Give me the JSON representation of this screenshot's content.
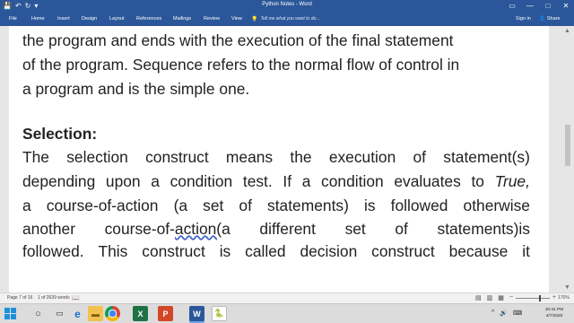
{
  "titlebar": {
    "title": "Python Notes - Word",
    "qat": {
      "save": "💾",
      "undo": "↶",
      "redo": "↻",
      "more": "▾"
    },
    "window_controls": {
      "ribbon_display": "▭",
      "minimize": "—",
      "maximize": "□",
      "close": "✕"
    }
  },
  "ribbon": {
    "tabs": [
      "File",
      "Home",
      "Insert",
      "Design",
      "Layout",
      "References",
      "Mailings",
      "Review",
      "View"
    ],
    "tell_me_icon": "💡",
    "tell_me_placeholder": "Tell me what you want to do...",
    "sign_in": "Sign in",
    "share_icon": "👤",
    "share": "Share"
  },
  "document": {
    "line1": "the program and ends with the execution of the final statement",
    "line2": "of the program. Sequence refers to the normal flow of control in",
    "line3": "a program and is the simple one.",
    "heading": "Selection:",
    "line5_words": [
      "The",
      "selection",
      "construct",
      "means",
      "the",
      "execution",
      "of",
      "statement(s)"
    ],
    "line6_words": [
      "depending",
      "upon",
      "a",
      "condition",
      "test.",
      "If",
      "a",
      "condition",
      "evaluates",
      "to"
    ],
    "line6_italic": "True,",
    "line7_words": [
      "a",
      "course-of-action",
      "(a",
      "set",
      "of",
      "statements)",
      "is",
      "followed",
      "otherwise"
    ],
    "line8": {
      "w1": "another",
      "w2_plain": "course-of-",
      "w2_underlined": "action(",
      "w3": "a",
      "w4": "different",
      "w5": "set",
      "w6": "of",
      "w7": "statements)is"
    },
    "line9_words": [
      "followed.",
      "This",
      "construct",
      "is",
      "called",
      "decision",
      "construct",
      "because",
      "it"
    ]
  },
  "scrollbar": {
    "up": "▲",
    "down": "▼"
  },
  "statusbar": {
    "page": "Page 7 of 16",
    "words": "1 of 2639 words",
    "proofing_icon": "📖",
    "view_icons": [
      "▤",
      "▥",
      "▦"
    ],
    "zoom_minus": "−",
    "zoom_plus": "+",
    "zoom": "170%",
    "zoom_fraction": 0.7
  },
  "taskbar": {
    "search_icon": "○",
    "taskview_icon": "▭",
    "ie": "e",
    "explorer": "▬",
    "excel": "X",
    "powerpoint": "P",
    "word": "W",
    "python": "🐍",
    "tray_icons": [
      "^",
      "🔊",
      "⌨"
    ],
    "time": "10:41 PM",
    "date": "4/7/2020"
  }
}
